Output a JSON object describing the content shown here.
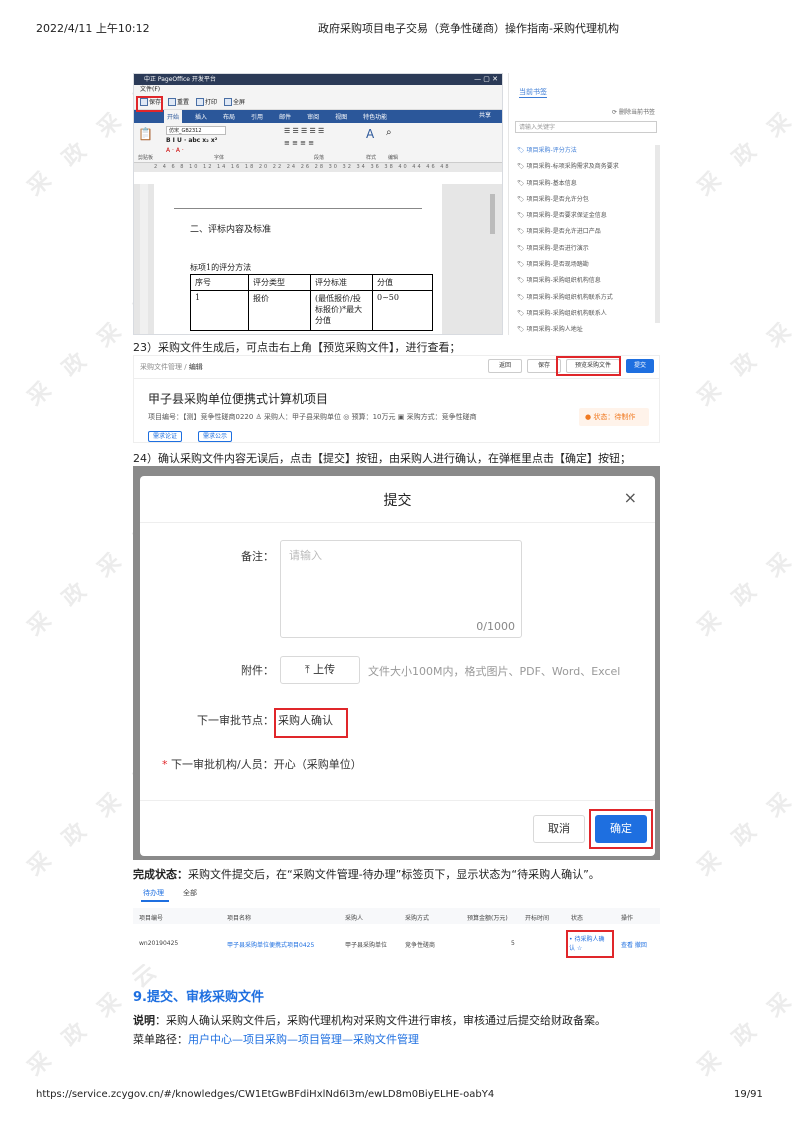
{
  "print_header": {
    "datetime": "2022/4/11 上午10:12",
    "doc_title": "政府采购项目电子交易（竞争性磋商）操作指南-采购代理机构"
  },
  "print_footer": {
    "url": "https://service.zcygov.cn/#/knowledges/CW1EtGwBFdiHxlNd6I3m/ewLD8m0BiyELHE-oabY4",
    "page": "19/91"
  },
  "watermark": "采 政 采 云",
  "editor": {
    "title": "中正 PageOffice 开发平台",
    "menu": "文件(F)",
    "qa_buttons": [
      "保存",
      "重置",
      "打印",
      "全屏"
    ],
    "ribbon_tabs": [
      "开始",
      "插入",
      "布局",
      "引用",
      "邮件",
      "审阅",
      "视图",
      "特色功能"
    ],
    "share": "共享",
    "font_name": "仿宋_GB2312",
    "groups": [
      "剪贴板",
      "字体",
      "段落",
      "样式",
      "编辑"
    ],
    "ruler": "2  4  6  8  10  12  14  16  18  20  22  24  26  28  30  32  34  36  38  40  44  46  48",
    "doc_heading": "二、评标内容及标准",
    "table_caption": "标项1的评分方法",
    "table_headers": [
      "序号",
      "评分类型",
      "评分标准",
      "分值"
    ],
    "table_row": [
      "1",
      "报价",
      "(最低报价/投标报价)*最大分值",
      "0~50"
    ]
  },
  "nav_pane": {
    "tab": "当前书签",
    "delete_label": "删除当前书签",
    "search_placeholder": "请输入关键字",
    "items": [
      "项目采购-评分方法",
      "项目采购-标项采购需求及商务要求",
      "项目采购-基本信息",
      "项目采购-是否允许分包",
      "项目采购-是否要求保证金信息",
      "项目采购-是否允许进口产品",
      "项目采购-是否进行演示",
      "项目采购-是否现场踏勘",
      "项目采购-采购组织机构信息",
      "项目采购-采购组织机构联系方式",
      "项目采购-采购组织机构联系人",
      "项目采购-采购人地址"
    ]
  },
  "step23": "23）采购文件生成后，可点击右上角【预览采购文件】，进行查看；",
  "preview_page": {
    "breadcrumb_parent": "采购文件管理",
    "breadcrumb_current": "编辑",
    "buttons": [
      "返回",
      "保存",
      "预览采购文件",
      "提交"
    ],
    "project_title": "甲子县采购单位便携式计算机项目",
    "info": "项目编号：【测】竞争性磋商0220  ♙ 采购人：甲子县采购单位  ◎ 预算：10万元  ▣ 采购方式：竞争性磋商",
    "status": "● 状态：待制作",
    "tags": [
      "需求论证",
      "需求公示"
    ]
  },
  "step24": "24）确认采购文件内容无误后，点击【提交】按钮，由采购人进行确认，在弹框里点击【确定】按钮；",
  "dialog": {
    "title": "提交",
    "close": "×",
    "remark_label": "备注：",
    "remark_placeholder": "请输入",
    "counter": "0/1000",
    "attach_label": "附件：",
    "upload_label": "⤒  上传",
    "upload_hint": "文件大小100M内，格式图片、PDF、Word、Excel",
    "next_node_label": "下一审批节点：",
    "next_node_value": "采购人确认",
    "next_org_label": "下一审批机构/人员：",
    "next_org_value": "开心（采购单位）",
    "cancel": "取消",
    "confirm": "确定"
  },
  "done_state": {
    "label": "完成状态：",
    "text": "采购文件提交后，在“采购文件管理-待办理”标签页下，显示状态为“待采购人确认”。"
  },
  "list": {
    "tabs": [
      "待办理",
      "全部"
    ],
    "headers": [
      "项目编号",
      "项目名称",
      "采购人",
      "采购方式",
      "预算金额(万元)",
      "开标时间",
      "状态",
      "操作"
    ],
    "row": {
      "code": "wn20190425",
      "name": "甲子县采购单位便携式项目0425",
      "buyer": "甲子县采购单位",
      "method": "竞争性磋商",
      "budget": "5",
      "open_time": "",
      "status_line1": "• 待采购人确",
      "status_line2": "认 ☆",
      "actions": "查看 撤回"
    }
  },
  "section": {
    "title": "9.提交、审核采购文件",
    "desc_label": "说明",
    "desc": "：采购人确认采购文件后，采购代理机构对采购文件进行审核，审核通过后提交给财政备案。",
    "path_label": "菜单路径：",
    "path": "用户中心—项目采购—项目管理—采购文件管理"
  },
  "colors": {
    "accent": "#1e6fe0",
    "highlight": "#e0262a",
    "status_orange": "#f07a22"
  }
}
